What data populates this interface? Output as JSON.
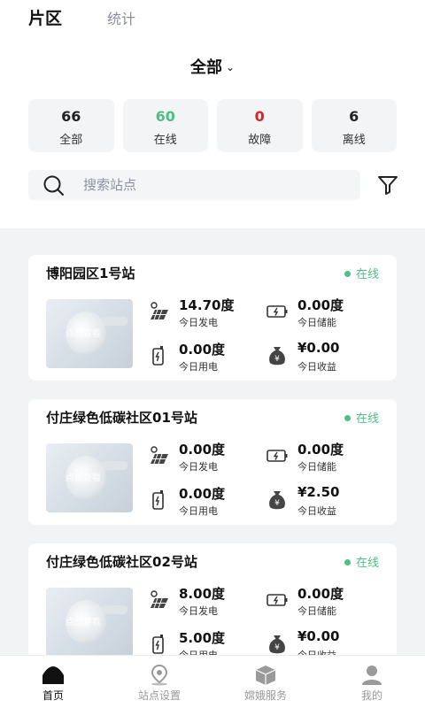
{
  "header": {
    "tab_active": "片区",
    "tab_inactive": "统计"
  },
  "region": {
    "label": "全部",
    "chevron": "⌄"
  },
  "stats": [
    {
      "value": "66",
      "label": "全部",
      "color": "#111111"
    },
    {
      "value": "60",
      "label": "在线",
      "color": "#4bbf86"
    },
    {
      "value": "0",
      "label": "故障",
      "color": "#e02020"
    },
    {
      "value": "6",
      "label": "离线",
      "color": "#111111"
    }
  ],
  "search": {
    "placeholder": "搜索站点",
    "icon": "search-icon"
  },
  "filter": {
    "icon": "filter-icon"
  },
  "stations": [
    {
      "name": "博阳园区1号站",
      "status": "在线",
      "generation": "14.70度",
      "generation_label": "今日发电",
      "storage": "0.00度",
      "storage_label": "今日储能",
      "usage": "0.00度",
      "usage_label": "今日用电",
      "income": "¥0.00",
      "income_label": "今日收益",
      "thumb_watermark": "点击查看"
    },
    {
      "name": "付庄绿色低碳社区01号站",
      "status": "在线",
      "generation": "0.00度",
      "generation_label": "今日发电",
      "storage": "0.00度",
      "storage_label": "今日储能",
      "usage": "0.00度",
      "usage_label": "今日用电",
      "income": "¥2.50",
      "income_label": "今日收益",
      "thumb_watermark": "点击查看"
    },
    {
      "name": "付庄绿色低碳社区02号站",
      "status": "在线",
      "generation": "8.00度",
      "generation_label": "今日发电",
      "storage": "0.00度",
      "storage_label": "今日储能",
      "usage": "5.00度",
      "usage_label": "今日用电",
      "income": "¥0.00",
      "income_label": "今日收益",
      "thumb_watermark": "点击查看"
    }
  ],
  "nav": [
    {
      "label": "首页",
      "icon": "home-icon",
      "active": true
    },
    {
      "label": "站点设置",
      "icon": "location-pin-icon",
      "active": false
    },
    {
      "label": "嫦娥服务",
      "icon": "box-icon",
      "active": false
    },
    {
      "label": "我的",
      "icon": "user-icon",
      "active": false
    }
  ],
  "colors": {
    "online": "#4bbf86",
    "fault": "#e02020",
    "card_bg": "#ffffff",
    "list_bg": "#f2f3f5"
  }
}
